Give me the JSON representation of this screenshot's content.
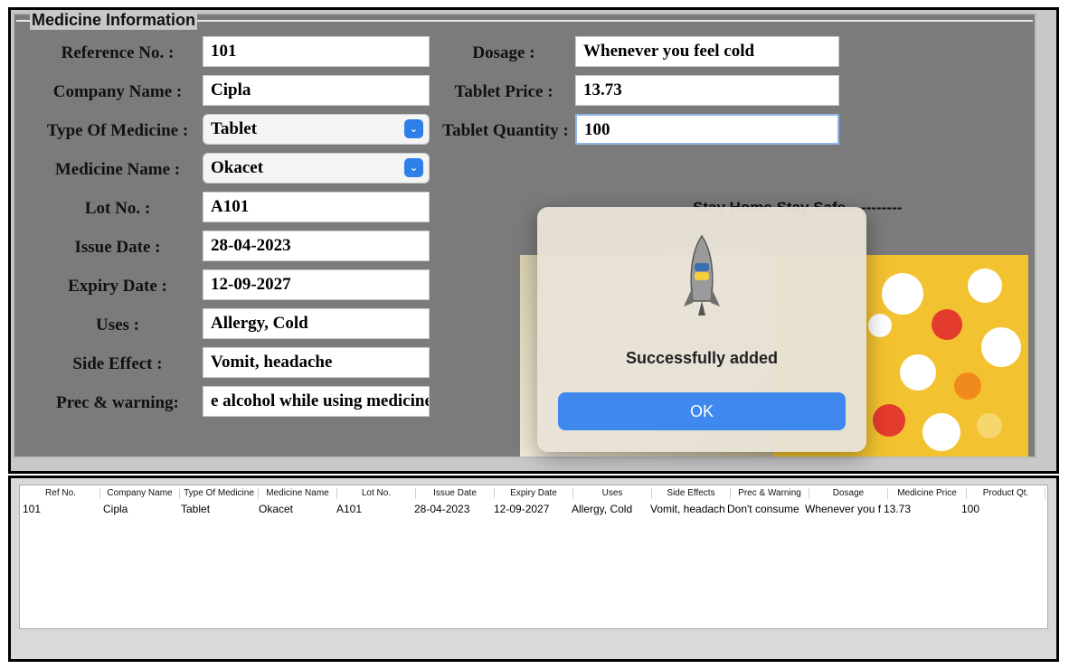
{
  "group_title": "Medicine Information",
  "form_left": [
    {
      "label": "Reference No. :",
      "value": "101"
    },
    {
      "label": "Company Name :",
      "value": "Cipla"
    },
    {
      "label": "Type Of Medicine :",
      "value": "Tablet"
    },
    {
      "label": "Medicine Name :",
      "value": "Okacet"
    },
    {
      "label": "Lot No. :",
      "value": "A101"
    },
    {
      "label": "Issue Date :",
      "value": "28-04-2023"
    },
    {
      "label": "Expiry Date :",
      "value": "12-09-2027"
    },
    {
      "label": "Uses :",
      "value": "Allergy, Cold"
    },
    {
      "label": "Side Effect :",
      "value": "Vomit, headache"
    },
    {
      "label": "Prec & warning:",
      "value": "e alcohol while using medicine"
    }
  ],
  "form_right": [
    {
      "label": "Dosage :",
      "value": "Whenever you feel cold"
    },
    {
      "label": "Tablet Price :",
      "value": "13.73"
    },
    {
      "label": "Tablet Quantity :",
      "value": "100"
    }
  ],
  "banner_text": "Stay Home Stay Safe-----------",
  "dialog": {
    "message": "Successfully added",
    "ok_label": "OK"
  },
  "table": {
    "headers": [
      "Ref No.",
      "Company Name",
      "Type Of Medicine",
      "Medicine Name",
      "Lot No.",
      "Issue Date",
      "Expiry Date",
      "Uses",
      "Side Effects",
      "Prec & Warning",
      "Dosage",
      "Medicine Price",
      "Product Qt."
    ],
    "rows": [
      [
        "101",
        "Cipla",
        "Tablet",
        "Okacet",
        "A101",
        "28-04-2023",
        "12-09-2027",
        "Allergy, Cold",
        "Vomit, headache",
        "Don't consume",
        "Whenever you feel cold",
        "13.73",
        "100"
      ]
    ]
  },
  "colors": {
    "panel": "#7b7b7b",
    "accent": "#3e88ee",
    "image_bg": "#f2c230"
  }
}
